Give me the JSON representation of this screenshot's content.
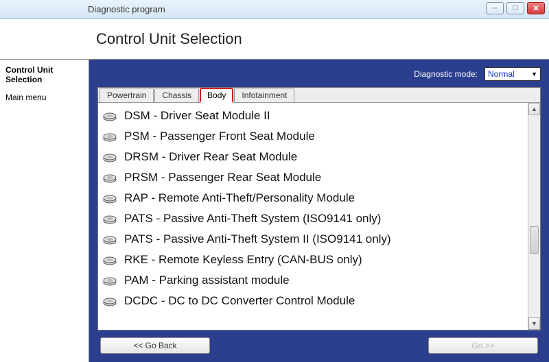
{
  "window": {
    "title": "Diagnostic program"
  },
  "header": {
    "title": "Control Unit Selection"
  },
  "sidebar": {
    "items": [
      {
        "label": "Control Unit Selection",
        "bold": true
      },
      {
        "label": "Main menu",
        "bold": false
      }
    ]
  },
  "diag": {
    "label": "Diagnostic mode:",
    "value": "Normal"
  },
  "tabs": [
    {
      "label": "Powertrain",
      "active": false
    },
    {
      "label": "Chassis",
      "active": false
    },
    {
      "label": "Body",
      "active": true
    },
    {
      "label": "Infotainment",
      "active": false
    }
  ],
  "modules": [
    "DSM - Driver Seat Module II",
    "PSM - Passenger Front Seat Module",
    "DRSM - Driver Rear Seat Module",
    "PRSM - Passenger Rear Seat Module",
    "RAP - Remote Anti-Theft/Personality Module",
    "PATS - Passive Anti-Theft System (ISO9141 only)",
    "PATS - Passive Anti-Theft System II (ISO9141 only)",
    "RKE - Remote Keyless Entry (CAN-BUS only)",
    "PAM - Parking assistant module",
    "DCDC - DC to DC Converter Control Module"
  ],
  "footer": {
    "back": "<< Go Back",
    "go": "Go >>"
  }
}
